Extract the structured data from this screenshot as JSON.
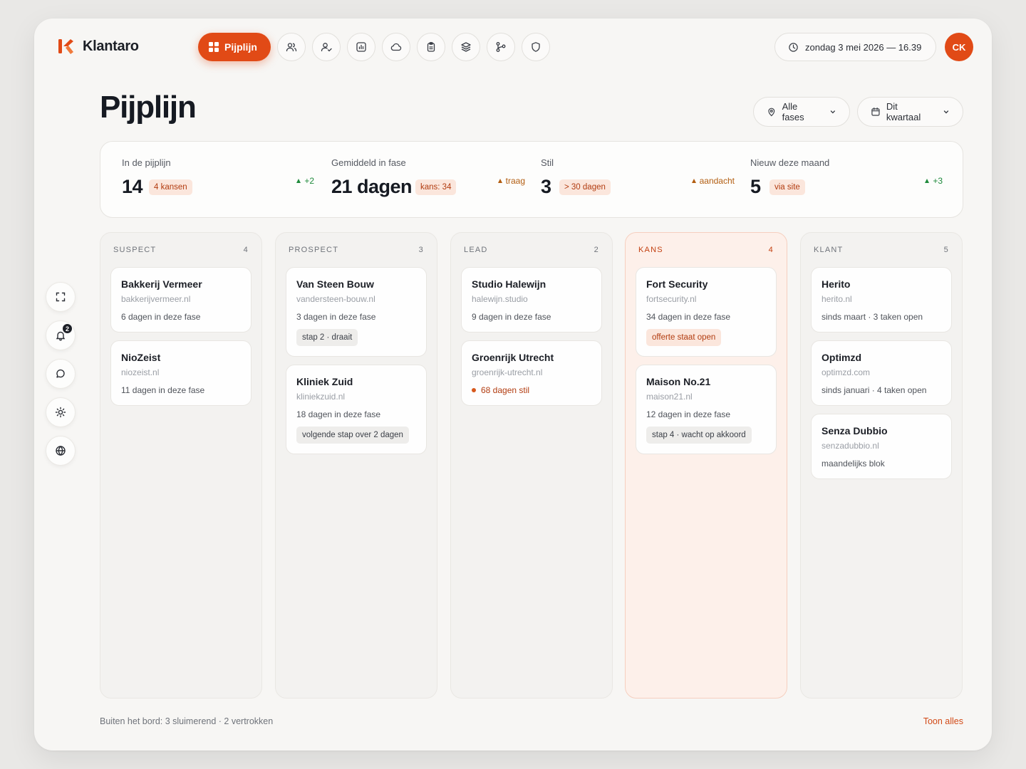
{
  "app": {
    "name": "Klantaro",
    "accent": "#e14a16"
  },
  "nav": {
    "active": {
      "label": "Pijplijn",
      "icon": "grid-icon"
    },
    "icons": [
      "users-icon",
      "user-check-icon",
      "chart-icon",
      "cloud-icon",
      "clipboard-icon",
      "layers-icon",
      "git-branch-icon",
      "shield-icon"
    ]
  },
  "header": {
    "datetime": "zondag 3 mei 2026 — 16.39",
    "avatar_initials": "CK"
  },
  "page": {
    "title": "Pijplijn"
  },
  "filters": {
    "phase": "Alle fases",
    "period": "Dit kwartaal"
  },
  "stats": [
    {
      "label": "In de pijplijn",
      "value": "14",
      "badge": "4 kansen",
      "trend": "+2",
      "trend_type": "up"
    },
    {
      "label": "Gemiddeld in fase",
      "value": "21 dagen",
      "badge": "kans: 34",
      "trend": "traag",
      "trend_type": "warn"
    },
    {
      "label": "Stil",
      "value": "3",
      "badge": "> 30 dagen",
      "trend": "aandacht",
      "trend_type": "warn"
    },
    {
      "label": "Nieuw deze maand",
      "value": "5",
      "badge": "via site",
      "trend": "+3",
      "trend_type": "up"
    }
  ],
  "side": {
    "notifications": "2"
  },
  "columns": [
    {
      "name": "SUSPECT",
      "count": "4",
      "highlight": false,
      "cards": [
        {
          "title": "Bakkerij Vermeer",
          "domain": "bakkerijvermeer.nl",
          "meta": "6 dagen in deze fase"
        },
        {
          "title": "NioZeist",
          "domain": "niozeist.nl",
          "meta": "11 dagen in deze fase"
        }
      ]
    },
    {
      "name": "PROSPECT",
      "count": "3",
      "highlight": false,
      "cards": [
        {
          "title": "Van Steen Bouw",
          "domain": "vandersteen-bouw.nl",
          "meta": "3 dagen in deze fase",
          "tag": "stap 2 · draait"
        },
        {
          "title": "Kliniek Zuid",
          "domain": "kliniekzuid.nl",
          "meta": "18 dagen in deze fase",
          "tag": "volgende stap over 2 dagen"
        }
      ]
    },
    {
      "name": "LEAD",
      "count": "2",
      "highlight": false,
      "cards": [
        {
          "title": "Studio Halewijn",
          "domain": "halewijn.studio",
          "meta": "9 dagen in deze fase"
        },
        {
          "title": "Groenrijk Utrecht",
          "domain": "groenrijk-utrecht.nl",
          "alert": "68 dagen stil"
        }
      ]
    },
    {
      "name": "KANS",
      "count": "4",
      "highlight": true,
      "cards": [
        {
          "title": "Fort Security",
          "domain": "fortsecurity.nl",
          "meta": "34 dagen in deze fase",
          "tag": "offerte staat open",
          "tag_style": "orange"
        },
        {
          "title": "Maison No.21",
          "domain": "maison21.nl",
          "meta": "12 dagen in deze fase",
          "tag": "stap 4 · wacht op akkoord"
        }
      ]
    },
    {
      "name": "KLANT",
      "count": "5",
      "highlight": false,
      "cards": [
        {
          "title": "Herito",
          "domain": "herito.nl",
          "meta": "sinds maart · 3 taken open"
        },
        {
          "title": "Optimzd",
          "domain": "optimzd.com",
          "meta": "sinds januari · 4 taken open"
        },
        {
          "title": "Senza Dubbio",
          "domain": "senzadubbio.nl",
          "meta": "maandelijks blok"
        }
      ]
    }
  ],
  "footer": {
    "left": "Buiten het bord: 3 sluimerend · 2 vertrokken",
    "right": "Toon alles"
  }
}
